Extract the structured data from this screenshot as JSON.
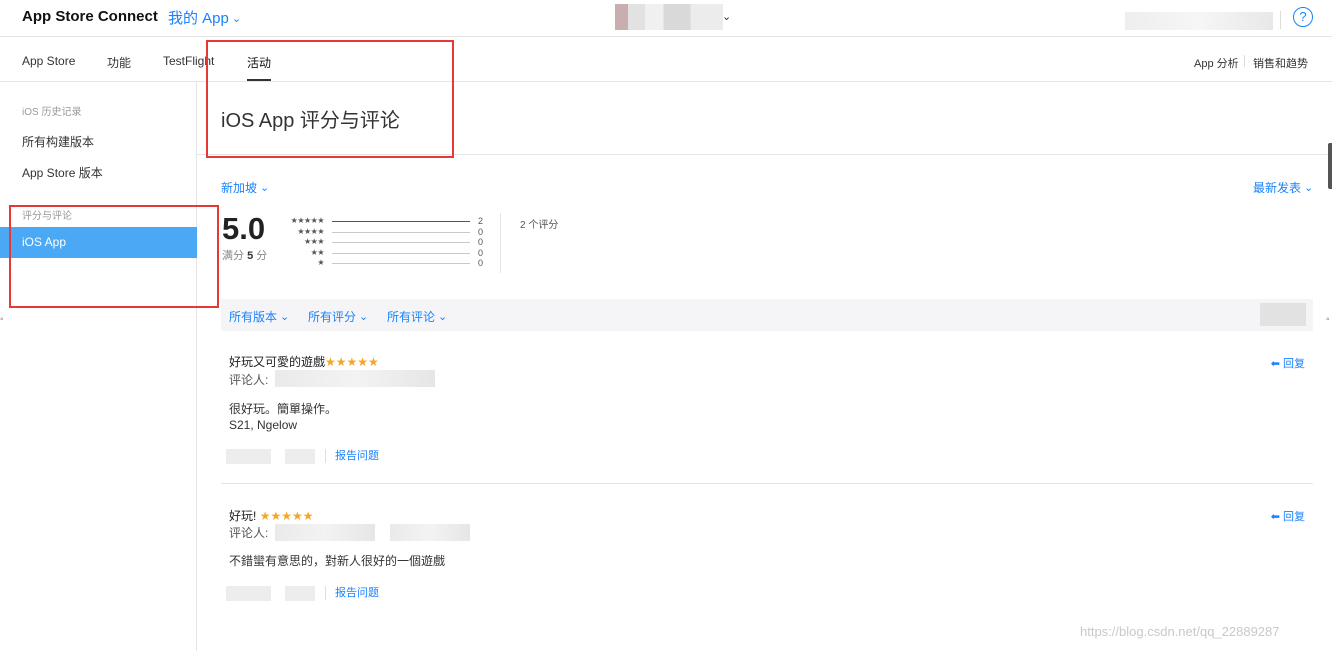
{
  "header": {
    "brand": "App Store Connect",
    "my_app": "我的 App",
    "help": "?"
  },
  "nav": {
    "tabs": [
      {
        "label": "App Store"
      },
      {
        "label": "功能"
      },
      {
        "label": "TestFlight"
      },
      {
        "label": "活动",
        "active": true
      }
    ],
    "right": [
      "App 分析",
      "销售和趋势"
    ]
  },
  "sidebar": {
    "history_heading": "iOS 历史记录",
    "items": [
      "所有构建版本",
      "App Store 版本"
    ],
    "ratings_heading": "评分与评论",
    "active_item": "iOS App"
  },
  "main": {
    "title": "iOS App 评分与评论",
    "region": "新加坡",
    "sort": "最新发表",
    "rating": {
      "average": "5.0",
      "max_prefix": "满分",
      "max_value": "5",
      "max_suffix": "分",
      "distribution": [
        {
          "stars": "★★★★★",
          "count": "2",
          "fraction": 1.0
        },
        {
          "stars": "★★★★",
          "count": "0",
          "fraction": 0
        },
        {
          "stars": "★★★",
          "count": "0",
          "fraction": 0
        },
        {
          "stars": "★★",
          "count": "0",
          "fraction": 0
        },
        {
          "stars": "★",
          "count": "0",
          "fraction": 0
        }
      ],
      "total": "2 个评分"
    },
    "filters": [
      "所有版本",
      "所有评分",
      "所有评论"
    ],
    "reviews": [
      {
        "title": "好玩又可愛的遊戲",
        "stars": "★★★★★",
        "reviewer_label": "评论人:",
        "body_lines": [
          "很好玩。簡單操作。",
          "S21, Ngelow"
        ],
        "reply": "回复",
        "report": "报告问题"
      },
      {
        "title": "好玩!",
        "stars": "★★★★★",
        "reviewer_label": "评论人:",
        "body_lines": [
          "不錯蠻有意思的，對新人很好的一個遊戲"
        ],
        "reply": "回复",
        "report": "报告问题"
      }
    ]
  },
  "watermark": "https://blog.csdn.net/qq_22889287",
  "colors": {
    "accent": "#1a82fb",
    "active": "#4aa8f5",
    "star": "#f5a623",
    "annotation": "#e53935"
  }
}
